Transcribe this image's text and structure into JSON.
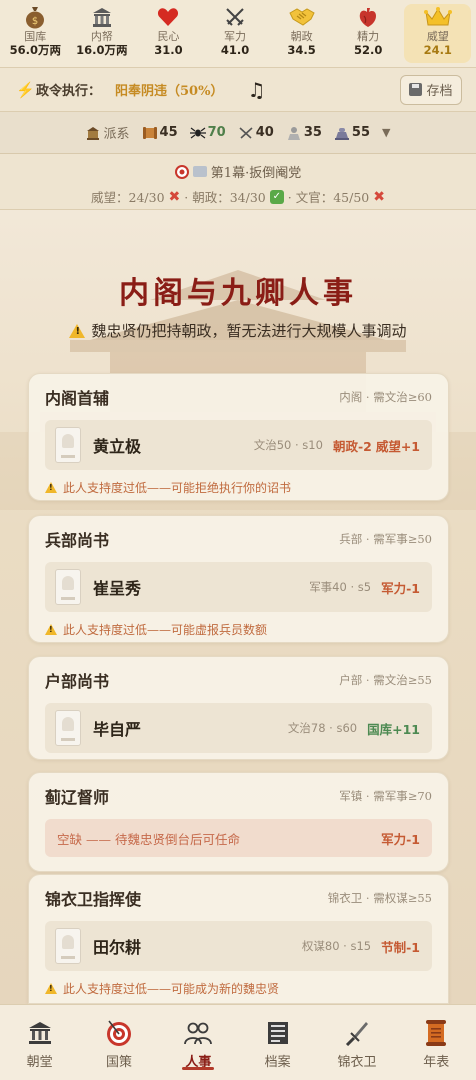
{
  "stats": [
    {
      "label": "国库",
      "value": "56.0万两",
      "icon": "money-bag-icon",
      "highlight": false
    },
    {
      "label": "内帑",
      "value": "16.0万两",
      "icon": "treasury-building-icon",
      "highlight": false
    },
    {
      "label": "民心",
      "value": "31.0",
      "icon": "heart-icon",
      "highlight": false
    },
    {
      "label": "军力",
      "value": "41.0",
      "icon": "crossed-swords-icon",
      "highlight": false
    },
    {
      "label": "朝政",
      "value": "34.5",
      "icon": "handshake-icon",
      "highlight": false
    },
    {
      "label": "精力",
      "value": "52.0",
      "icon": "anatomical-heart-icon",
      "highlight": false
    },
    {
      "label": "威望",
      "value": "24.1",
      "icon": "crown-icon",
      "highlight": true
    }
  ],
  "edict": {
    "label": "政令执行：",
    "value": "阳奉阴违（50%）",
    "save_label": "存档"
  },
  "factions": {
    "label": "派系",
    "items": [
      {
        "icon": "scroll-icon",
        "value": "45",
        "color": "#3a2f23"
      },
      {
        "icon": "spider-icon",
        "value": "70",
        "color": "#4f7f4a"
      },
      {
        "icon": "crossed-swords-icon",
        "value": "40",
        "color": "#3a2f23"
      },
      {
        "icon": "scholar-icon",
        "value": "35",
        "color": "#3a2f23"
      },
      {
        "icon": "crowd-icon",
        "value": "55",
        "color": "#3a2f23"
      }
    ]
  },
  "mission": {
    "title": "第1幕·扳倒阉党",
    "goals": [
      {
        "text": "威望：24/30",
        "done": false
      },
      {
        "text": "· 朝政：34/30",
        "done": true
      },
      {
        "text": "· 文官：45/50",
        "done": false
      }
    ]
  },
  "main": {
    "title": "内阁与九卿人事",
    "warning": "魏忠贤仍把持朝政，暂无法进行大规模人事调动",
    "cards": [
      {
        "title": "内阁首辅",
        "req": "内阁 · 需文治≥60",
        "person": "黄立极",
        "stat": "文治50 · s10",
        "effects": [
          {
            "text": "朝政-2",
            "tone": "red"
          },
          {
            "text": "威望+1",
            "tone": "red"
          }
        ],
        "warn": "此人支持度过低——可能拒绝执行你的诏书"
      },
      {
        "title": "兵部尚书",
        "req": "兵部 · 需军事≥50",
        "person": "崔呈秀",
        "stat": "军事40 · s5",
        "effects": [
          {
            "text": "军力-1",
            "tone": "red"
          }
        ],
        "warn": "此人支持度过低——可能虚报兵员数额"
      },
      {
        "title": "户部尚书",
        "req": "户部 · 需文治≥55",
        "person": "毕自严",
        "stat": "文治78 · s60",
        "effects": [
          {
            "text": "国库+11",
            "tone": "grn"
          }
        ],
        "warn": ""
      },
      {
        "title": "蓟辽督师",
        "req": "军镇 · 需军事≥70",
        "vacant": "空缺 —— 待魏忠贤倒台后可任命",
        "vacant_effect": "军力-1"
      },
      {
        "title": "锦衣卫指挥使",
        "req": "锦衣卫 · 需权谋≥55",
        "person": "田尔耕",
        "stat": "权谋80 · s15",
        "effects": [
          {
            "text": "节制-1",
            "tone": "red"
          }
        ],
        "warn": "此人支持度过低——可能成为新的魏忠贤"
      }
    ]
  },
  "nav": [
    {
      "label": "朝堂",
      "icon": "court-building-icon",
      "active": false
    },
    {
      "label": "国策",
      "icon": "target-icon",
      "active": false
    },
    {
      "label": "人事",
      "icon": "people-icon",
      "active": true
    },
    {
      "label": "档案",
      "icon": "archive-icon",
      "active": false
    },
    {
      "label": "锦衣卫",
      "icon": "dagger-icon",
      "active": false
    },
    {
      "label": "年表",
      "icon": "scroll-icon",
      "active": false
    }
  ]
}
